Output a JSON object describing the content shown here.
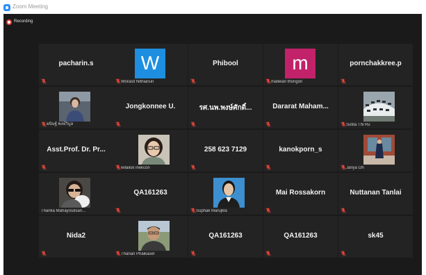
{
  "window": {
    "title": "Zoom Meeting"
  },
  "recording": {
    "label": "Recording"
  },
  "colors": {
    "accent": "#2d8cff",
    "mute": "#e8443a",
    "tile_bg": "#232323",
    "meeting_bg": "#1a1a1a"
  },
  "tiles": {
    "t1": {
      "name": "pacharin.s"
    },
    "t2": {
      "avatar_letter": "W",
      "label": "Worasit Nithianun"
    },
    "t3": {
      "name": "Phibool"
    },
    "t4": {
      "avatar_letter": "m",
      "label": "maliwan thongon"
    },
    "t5": {
      "name": "pornchakkree.p"
    },
    "t6": {
      "label": "ผนิษฐ์ พงษ์วิบูล"
    },
    "t7": {
      "name": "Jongkonnee U."
    },
    "t8": {
      "name": "รศ.นพ.พงษ์ศักดิ์..."
    },
    "t9": {
      "name": "Dararat Maham..."
    },
    "t10": {
      "label": "Sutita Thi Ru"
    },
    "t11": {
      "name": "Asst.Prof. Dr. Pr..."
    },
    "t12": {
      "label": "wilailuk inekcon"
    },
    "t13": {
      "name": "258 623 7129"
    },
    "t14": {
      "name": "kanokporn_s"
    },
    "t15": {
      "label": "Jariya Oh"
    },
    "t16": {
      "label": "Tharika Mahayosdsan..."
    },
    "t17": {
      "name": "QA161263"
    },
    "t18": {
      "label": "Suphak Marujkla"
    },
    "t19": {
      "name": "Mai Rossakorn"
    },
    "t20": {
      "name": "Nuttanan Tanlai"
    },
    "t21": {
      "name": "Nida2"
    },
    "t22": {
      "label": "Thanan Phaikaset"
    },
    "t23": {
      "name": "QA161263"
    },
    "t24": {
      "name": "QA161263"
    },
    "t25": {
      "name": "sk45"
    }
  }
}
